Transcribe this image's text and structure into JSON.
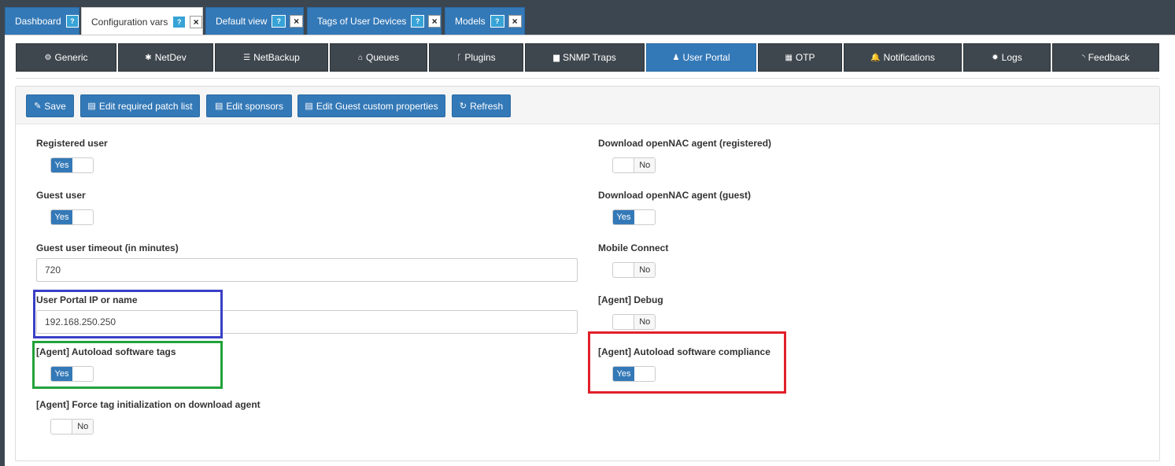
{
  "top_tabs": [
    {
      "label": "Dashboard",
      "help": "?",
      "close": ""
    },
    {
      "label": "Configuration vars",
      "help": "?",
      "close": "×"
    },
    {
      "label": "Default view",
      "help": "?",
      "close": "×"
    },
    {
      "label": "Tags of User Devices",
      "help": "?",
      "close": "×"
    },
    {
      "label": "Models",
      "help": "?",
      "close": "×"
    }
  ],
  "sub_nav": [
    {
      "label": "Generic",
      "icon": "cogs-icon",
      "glyph": "⚙"
    },
    {
      "label": "NetDev",
      "icon": "gear-icon",
      "glyph": "✱"
    },
    {
      "label": "NetBackup",
      "icon": "database-icon",
      "glyph": "☰"
    },
    {
      "label": "Queues",
      "icon": "inbox-icon",
      "glyph": "⌂"
    },
    {
      "label": "Plugins",
      "icon": "code-fork-icon",
      "glyph": "ᚴ"
    },
    {
      "label": "SNMP Traps",
      "icon": "briefcase-icon",
      "glyph": "▆"
    },
    {
      "label": "User Portal",
      "icon": "user-icon",
      "glyph": "♟"
    },
    {
      "label": "OTP",
      "icon": "qrcode-icon",
      "glyph": "▦"
    },
    {
      "label": "Notifications",
      "icon": "bell-icon",
      "glyph": "🔔"
    },
    {
      "label": "Logs",
      "icon": "bug-icon",
      "glyph": "✹"
    },
    {
      "label": "Feedback",
      "icon": "rss-icon",
      "glyph": "◝"
    }
  ],
  "toolbar": {
    "save": "Save",
    "edit_patch": "Edit required patch list",
    "edit_sponsors": "Edit sponsors",
    "edit_guest": "Edit Guest custom properties",
    "refresh": "Refresh"
  },
  "fields": {
    "registered_user": {
      "label": "Registered user",
      "value": "Yes"
    },
    "guest_user": {
      "label": "Guest user",
      "value": "Yes"
    },
    "guest_timeout": {
      "label": "Guest user timeout (in minutes)",
      "value": "720"
    },
    "portal_ip": {
      "label": "User Portal IP or name",
      "value": "192.168.250.250"
    },
    "autoload_tags": {
      "label": "[Agent] Autoload software tags",
      "value": "Yes"
    },
    "force_tag_init": {
      "label": "[Agent] Force tag initialization on download agent",
      "value": "No"
    },
    "dl_registered": {
      "label": "Download openNAC agent (registered)",
      "value": "No"
    },
    "dl_guest": {
      "label": "Download openNAC agent (guest)",
      "value": "Yes"
    },
    "mobile_connect": {
      "label": "Mobile Connect",
      "value": "No"
    },
    "agent_debug": {
      "label": "[Agent] Debug",
      "value": "No"
    },
    "autoload_compliance": {
      "label": "[Agent] Autoload software compliance",
      "value": "Yes"
    }
  },
  "colors": {
    "accent": "#3479b7",
    "highlight_blue": "#3a3fc6",
    "highlight_green": "#22a23a",
    "highlight_red": "#e0202a"
  }
}
